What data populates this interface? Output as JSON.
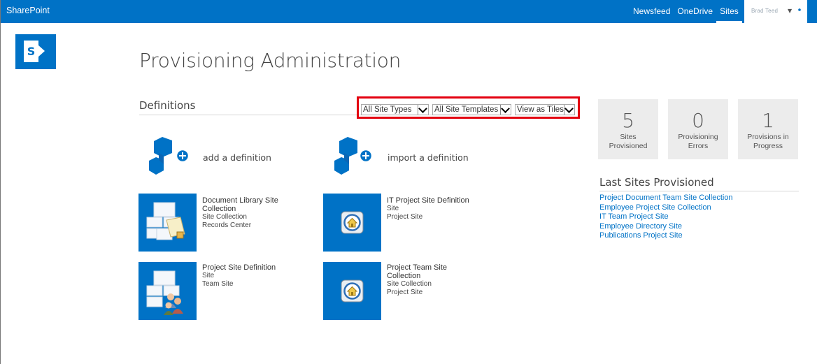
{
  "suitebar": {
    "brand": "SharePoint",
    "links": [
      {
        "label": "Newsfeed",
        "active": false
      },
      {
        "label": "OneDrive",
        "active": false
      },
      {
        "label": "Sites",
        "active": true
      }
    ],
    "user_name": "Brad Teed",
    "accent_color": "#0072c6"
  },
  "page": {
    "title": "Provisioning Administration"
  },
  "definitions": {
    "heading": "Definitions",
    "filters": {
      "site_type": "All Site Types",
      "site_template": "All Site Templates",
      "view": "View as Tiles"
    },
    "actions": {
      "add": "add a definition",
      "import": "import a definition"
    },
    "tiles": [
      {
        "title": "Document Library Site Collection",
        "line1": "Site Collection",
        "line2": "Records Center",
        "icon": "records-center-icon"
      },
      {
        "title": "IT Project Site Definition",
        "line1": "Site",
        "line2": "Project Site",
        "icon": "home-icon"
      },
      {
        "title": "Project Site Definition",
        "line1": "Site",
        "line2": "Team Site",
        "icon": "team-site-icon"
      },
      {
        "title": "Project Team Site Collection",
        "line1": "Site Collection",
        "line2": "Project Site",
        "icon": "home-icon"
      }
    ]
  },
  "stats": [
    {
      "value": "5",
      "label": "Sites Provisioned"
    },
    {
      "value": "0",
      "label": "Provisioning Errors"
    },
    {
      "value": "1",
      "label": "Provisions in Progress"
    }
  ],
  "last_sites": {
    "heading": "Last Sites Provisioned",
    "items": [
      "Project Document Team Site Collection",
      "Employee Project Site Collection",
      "IT Team Project Site",
      "Employee Directory Site",
      "Publications Project Site"
    ]
  }
}
